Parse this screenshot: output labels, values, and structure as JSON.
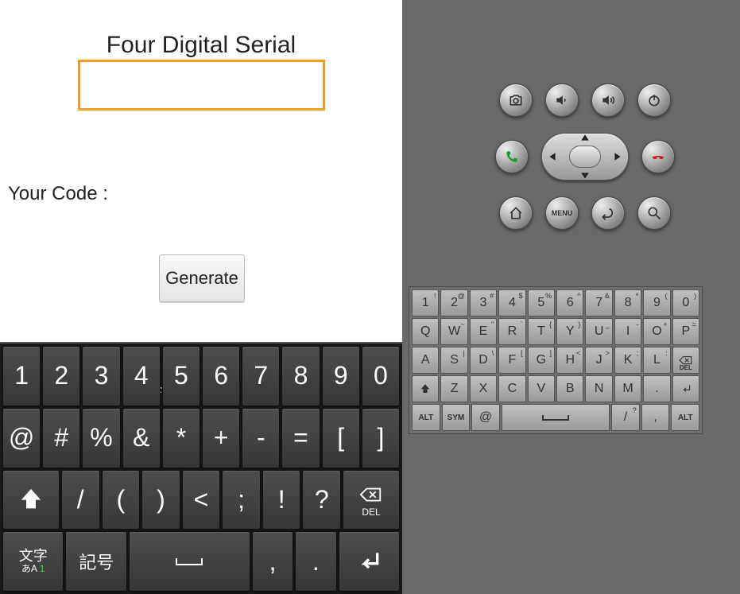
{
  "app": {
    "title": "Four Digital Serial",
    "serial_value": "",
    "code_label": "Your Code :",
    "generate_label": "Generate"
  },
  "softkbd": {
    "row1": [
      "1",
      "2",
      "3",
      "4",
      "5",
      "6",
      "7",
      "8",
      "9",
      "0"
    ],
    "row2": [
      "@",
      "#",
      "%",
      "&",
      "*",
      "+",
      "-",
      "=",
      "[",
      "]"
    ],
    "row3_keys": [
      "/",
      "(",
      ")",
      "<",
      ";",
      "!",
      "?"
    ],
    "shift_label": "⇧",
    "del_label": "DEL",
    "row4": {
      "moji_main": "文字",
      "moji_sub": "あA",
      "moji_num": "1",
      "kigo": "記号",
      "comma": ",",
      "period": "."
    }
  },
  "hw_buttons": {
    "camera": "camera-icon",
    "vol_down": "volume-down-icon",
    "vol_up": "volume-up-icon",
    "power": "power-icon",
    "call": "call-icon",
    "end": "end-call-icon",
    "home": "home-icon",
    "menu": "MENU",
    "back": "back-icon",
    "search": "search-icon"
  },
  "hwkbd": {
    "row1": [
      {
        "main": "1",
        "sup": "!"
      },
      {
        "main": "2",
        "sup": "@"
      },
      {
        "main": "3",
        "sup": "#"
      },
      {
        "main": "4",
        "sup": "$"
      },
      {
        "main": "5",
        "sup": "%"
      },
      {
        "main": "6",
        "sup": "^"
      },
      {
        "main": "7",
        "sup": "&"
      },
      {
        "main": "8",
        "sup": "*"
      },
      {
        "main": "9",
        "sup": "("
      },
      {
        "main": "0",
        "sup": ")"
      }
    ],
    "row2": [
      {
        "main": "Q",
        "sup": ""
      },
      {
        "main": "W",
        "sup": "~"
      },
      {
        "main": "E",
        "sup": "\""
      },
      {
        "main": "R",
        "sup": "`"
      },
      {
        "main": "T",
        "sup": "{"
      },
      {
        "main": "Y",
        "sup": "}"
      },
      {
        "main": "U",
        "sup": "_"
      },
      {
        "main": "I",
        "sup": "-"
      },
      {
        "main": "O",
        "sup": "+"
      },
      {
        "main": "P",
        "sup": "="
      }
    ],
    "row3": [
      {
        "main": "A",
        "sup": ""
      },
      {
        "main": "S",
        "sup": "|"
      },
      {
        "main": "D",
        "sup": "\\"
      },
      {
        "main": "F",
        "sup": "["
      },
      {
        "main": "G",
        "sup": "]"
      },
      {
        "main": "H",
        "sup": "<"
      },
      {
        "main": "J",
        "sup": ">"
      },
      {
        "main": "K",
        "sup": ";"
      },
      {
        "main": "L",
        "sup": ":"
      }
    ],
    "row3_del": "DEL",
    "row4_shift": "⇧",
    "row4": [
      {
        "main": "Z",
        "sup": ""
      },
      {
        "main": "X",
        "sup": ""
      },
      {
        "main": "C",
        "sup": ""
      },
      {
        "main": "V",
        "sup": ""
      },
      {
        "main": "B",
        "sup": ""
      },
      {
        "main": "N",
        "sup": ""
      },
      {
        "main": "M",
        "sup": ""
      },
      {
        "main": ".",
        "sup": ""
      }
    ],
    "row5_alt": "ALT",
    "row5_sym": "SYM",
    "row5_at": "@",
    "row5_slash": "/",
    "row5_comma": ",",
    "row5_q": "?",
    "row5_altR": "ALT"
  }
}
